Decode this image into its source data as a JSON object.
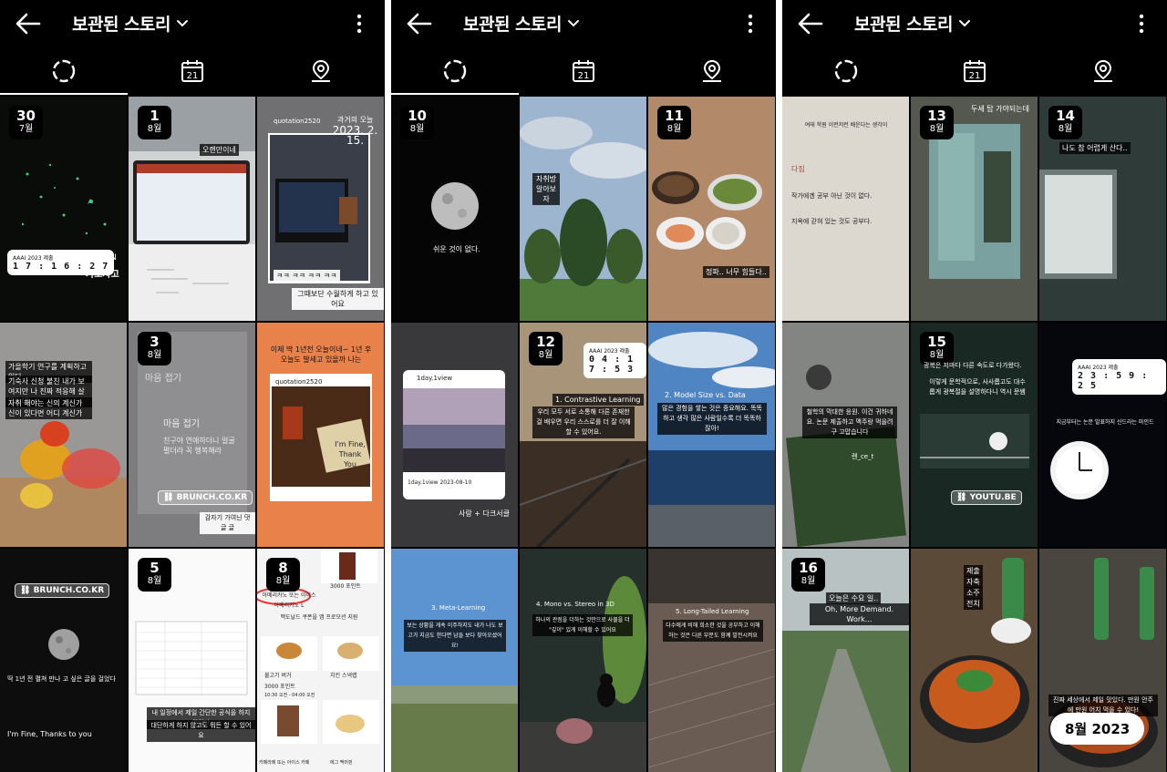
{
  "header": {
    "title": "보관된 스토리"
  },
  "tabs": [
    "archive",
    "calendar",
    "location"
  ],
  "panel1": {
    "cells": [
      {
        "day": "30",
        "month": "7월",
        "clock": "1 7 : 1 6 : 2 7",
        "clock_label": "AAAI 2023 제출",
        "text1": "방생모드 ON",
        "text2": "가보자고"
      },
      {
        "day": "1",
        "month": "8월",
        "text1": "오랜만이네"
      },
      {
        "overlay_top": "quotation2520",
        "overlay_top2": "과거의 오늘",
        "overlay_date": "2023. 2. 15.",
        "text1": "ㅋㅋ ㅋㅋ ㅋㅋ ㅋㅋ",
        "text2": "그때보단 수월하게 하고 있어요"
      },
      {
        "text1": "가을학기 연구를 계획하고 있다.",
        "text2": "기숙사 신청 불친 내가 보여지만 나 진짜 적응해 살았는데",
        "text3": "자취 해야는 신의 계신가 신이 있다면 어디 계신가"
      },
      {
        "day": "3",
        "month": "8월",
        "text1": "마음 접기",
        "text2": "마음 접기",
        "text3": "친구야 연애하더니 얼굴 펼더라 꼭 행복해라",
        "link": "BRUNCH.CO.KR",
        "text4": "감자기 가여닌 댓글 글"
      },
      {
        "text1": "이제 딱 1년전 오늘이네~ 1년 후 오늘도 발세고 있을까 나는",
        "overlay": "quotation2520",
        "text2": "I'm Fine, Thank You"
      },
      {
        "link": "BRUNCH.CO.KR",
        "text1": "딱 1년 전 펼쳐 만나 고 싶은 글을 걸었다",
        "text2": "I'm Fine, Thanks to you"
      },
      {
        "day": "5",
        "month": "8월",
        "text1": "내 일정에서 제일 간단한 공식을 하지 않았다",
        "text2": "대단하게 하지 않고도 뭐든 할 수 있어요"
      },
      {
        "day": "8",
        "month": "8월",
        "text1": "아메리카노 또는 아이스 아메리카노 L",
        "text2": "3000 포인트",
        "text3": "맥도날드 쿠폰을 앱 프로모션 지원",
        "text4": "불고기 버거",
        "text5": "치킨 스낵랩",
        "text6": "3000 포인트",
        "text7": "10:30 오전 - 04:00 오전",
        "text8": "카페라떼 또는 아이스 카페",
        "text9": "에그 맥머핀"
      }
    ]
  },
  "panel2": {
    "cells": [
      {
        "day": "10",
        "month": "8월",
        "text1": "쉬운 것이 없다."
      },
      {
        "text1": "자취방 알아보자"
      },
      {
        "day": "11",
        "month": "8월",
        "text1": "정파.. 너무 힘들다.."
      },
      {
        "card_title": "1day.1view",
        "card_caption": "1day.1view 2023-08-10",
        "text1": "사랑 + 다크서클"
      },
      {
        "day": "12",
        "month": "8월",
        "clock": "0 4 : 1 7 : 5 3",
        "clock_label": "AAAI 2023 제출",
        "text1": "1. Contrastive Learning",
        "text2": "우리 모두 서로 소통해 다른 존재한 걸 배우면 우리 스스로를 더 잘 이해할 수 있어요."
      },
      {
        "text1": "2. Model Size vs. Data",
        "text2": "많은 경험을 쌓는 것은 중요해요. 똑똑하고 생각 많은 사람일수록 더 똑똑하잖아!"
      },
      {
        "text1": "3. Meta-Learning",
        "text2": "보는 상황을 게속 이주하지도 내가 나도 보고가 지금도 한다면 남들 보다 찾아오셨어요!"
      },
      {
        "text1": "4. Mono vs. Stereo in 3D",
        "text2": "하나의 관점을 더하는 것만으로 사물을 더 \"깊이\" 있게 이해할 수 있어요"
      },
      {
        "text1": "5. Long-Tailed Learning",
        "text2": "다수에게 비해 희소한 것을 공부하고 이해하는 것은 다른 부분도 함께 발전시켜요"
      }
    ]
  },
  "panel3": {
    "cells": [
      {
        "text1": "여태 학원 이런저런 배운다는 생각이",
        "text2": "다짐",
        "text3": "작가에겐 공부 아닌 것이 없다.",
        "text4": "지옥에 갇혀 있는 것도 공부다."
      },
      {
        "day": "13",
        "month": "8월",
        "text1": "두세 탑 가야되는데"
      },
      {
        "day": "14",
        "month": "8월",
        "text1": "나도 참 어렵게 산다.."
      },
      {
        "text1": "철학의 막대한 응원. 이건 귀하네요. 논문 제출하고 맥주랑 먹을려구 고맙습니다",
        "text2": "렌_ce_t"
      },
      {
        "day": "15",
        "month": "8월",
        "text1": "광복은 저마다 다른 속도로 다가왔다.",
        "text2": "이렇게 문학적으로, 사사롭고도 대수롭게 광복절을 설명하다니 역시 문쌤",
        "link": "YOUTU.BE"
      },
      {
        "clock": "2 3 : 5 9 : 2 5",
        "clock_label": "AAAI 2023 제출",
        "text1": "지금부터는 논문 발표하지 신드라는 마인드"
      },
      {
        "day": "16",
        "month": "8월",
        "text1": "오늘은 수요 일..",
        "text2": "Oh, More Demand. Work..."
      },
      {
        "text1": "제출",
        "text2": "자축",
        "text3": "소주",
        "text4": "전치"
      },
      {
        "text1": "진짜 세상에서 제일 맛있다. 만원 안주에 만원 어치 먹을 수 있다!",
        "pill": "8월 2023"
      }
    ]
  }
}
